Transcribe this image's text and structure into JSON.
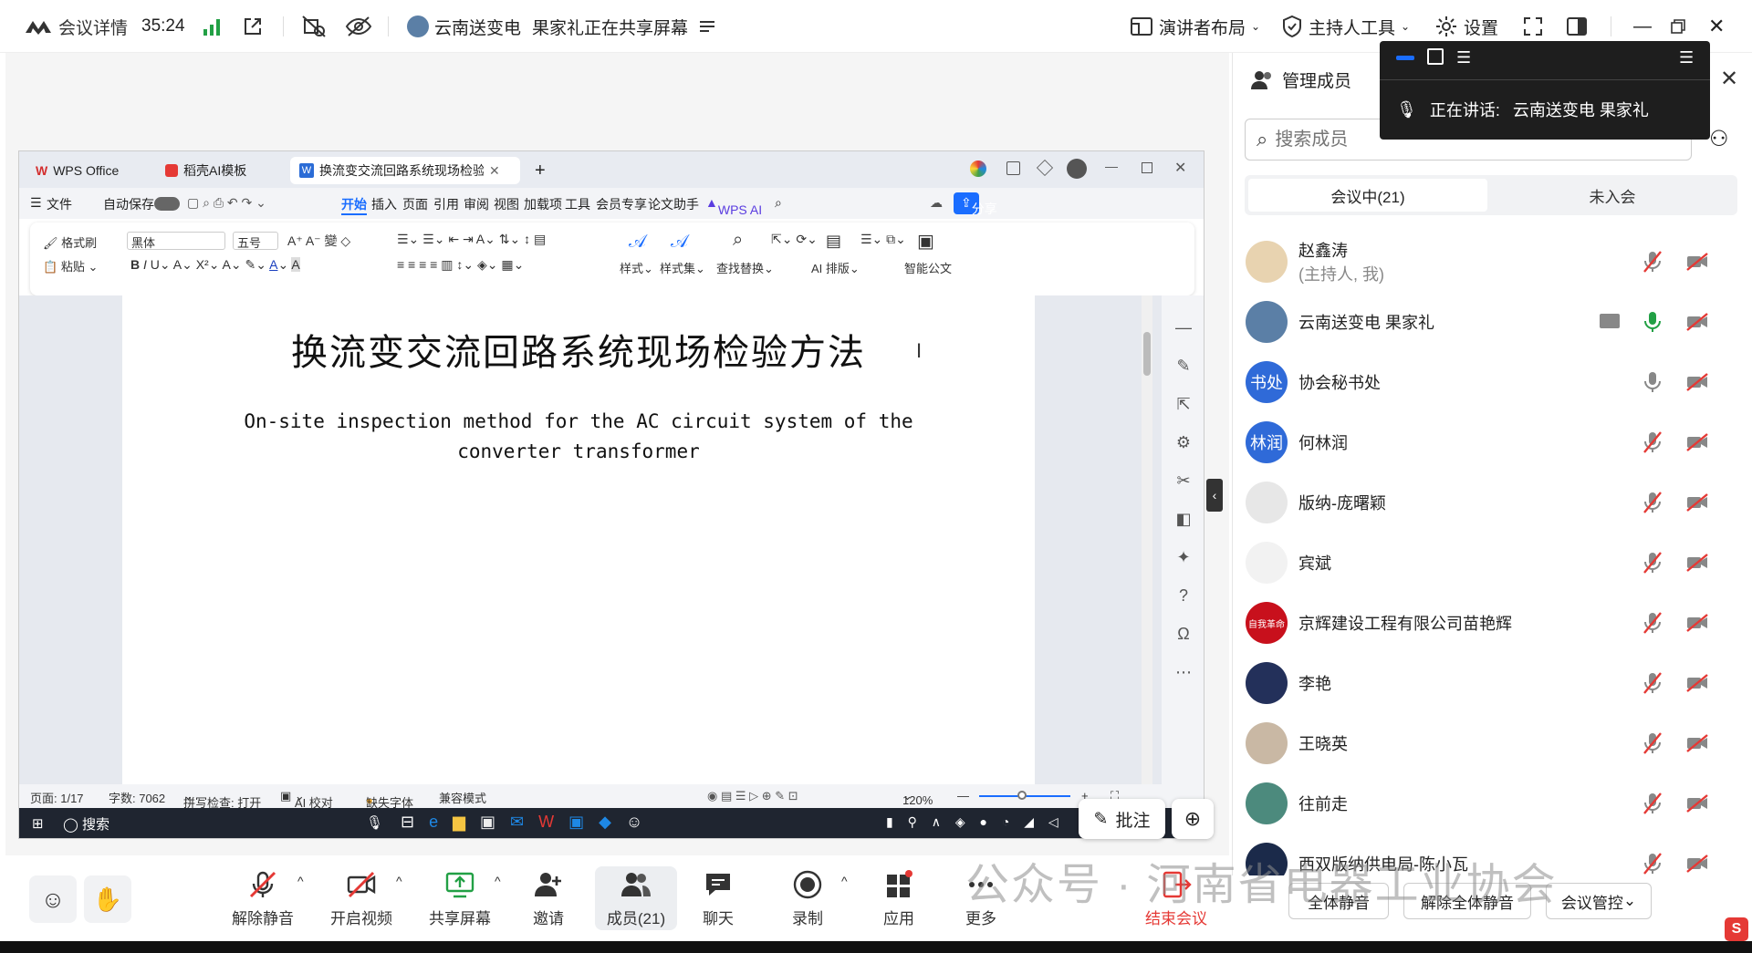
{
  "topbar": {
    "meeting_details": "会议详情",
    "timer": "35:24",
    "sharer_org": "云南送变电",
    "sharer_status": "果家礼正在共享屏幕",
    "presenter_layout": "演讲者布局",
    "host_tools": "主持人工具",
    "settings": "设置"
  },
  "wps": {
    "tabs": [
      {
        "label": "WPS Office"
      },
      {
        "label": "稻壳AI模板"
      },
      {
        "label": "换流变交流回路系统现场检验"
      }
    ],
    "menu": {
      "file": "文件",
      "autosave": "自动保存",
      "items": [
        "开始",
        "插入",
        "页面",
        "引用",
        "审阅",
        "视图",
        "加载项",
        "工具",
        "会员专享",
        "论文助手"
      ],
      "wps_ai": "WPS AI",
      "share": "分享"
    },
    "ribbon": {
      "format_painter": "格式刷",
      "paste": "粘贴",
      "font_name": "黑体",
      "font_size": "五号",
      "style": "样式",
      "style_set": "样式集",
      "find_replace": "查找替换",
      "ai_layout": "AI 排版",
      "smart_doc": "智能公文"
    },
    "document": {
      "title": "换流变交流回路系统现场检验方法",
      "subtitle": "On-site inspection method for the AC circuit system of the converter transformer"
    },
    "status": {
      "page": "页面: 1/17",
      "word_count": "字数: 7062",
      "spell_check": "拼写检查: 打开",
      "ai_proofread": "AI 校对",
      "missing_font": "缺失字体",
      "compat_mode": "兼容模式",
      "zoom": "120%"
    },
    "taskbar": {
      "search": "搜索"
    }
  },
  "annotate_button": "批注",
  "panel": {
    "title": "管理成员",
    "search_placeholder": "搜索成员",
    "tab_in_meeting": "会议中(21)",
    "tab_not_joined": "未入会",
    "members": [
      {
        "name": "赵鑫涛",
        "sub": "(主持人, 我)",
        "avatar_text": "",
        "color": "#e8d3b0"
      },
      {
        "name": "云南送变电  果家礼",
        "sub": "",
        "avatar_text": "",
        "color": "#5b7fa6"
      },
      {
        "name": "协会秘书处",
        "sub": "",
        "avatar_text": "书处",
        "color": "#2f6ad8"
      },
      {
        "name": "何林润",
        "sub": "",
        "avatar_text": "林润",
        "color": "#2f6ad8"
      },
      {
        "name": "版纳-庞曙颖",
        "sub": "",
        "avatar_text": "",
        "color": "#e7e7e7"
      },
      {
        "name": "宾斌",
        "sub": "",
        "avatar_text": "",
        "color": "#f2f2f2"
      },
      {
        "name": "京辉建设工程有限公司苗艳辉",
        "sub": "",
        "avatar_text": "自我革命",
        "color": "#c8101c"
      },
      {
        "name": "李艳",
        "sub": "",
        "avatar_text": "",
        "color": "#23305a"
      },
      {
        "name": "王晓英",
        "sub": "",
        "avatar_text": "",
        "color": "#c9b8a4"
      },
      {
        "name": "往前走",
        "sub": "",
        "avatar_text": "",
        "color": "#4c8a7d"
      },
      {
        "name": "西双版纳供电局-陈小瓦",
        "sub": "",
        "avatar_text": "",
        "color": "#1b2a4a"
      }
    ],
    "mute_all": "全体静音",
    "unmute_all": "解除全体静音",
    "meeting_control": "会议管控"
  },
  "floater": {
    "speaking_label": "正在讲话:",
    "speaker": "云南送变电  果家礼"
  },
  "bottombar": {
    "unmute": "解除静音",
    "start_video": "开启视频",
    "share_screen": "共享屏幕",
    "invite": "邀请",
    "members": "成员(21)",
    "chat": "聊天",
    "record": "录制",
    "apps": "应用",
    "more": "更多",
    "end_meeting": "结束会议"
  },
  "watermark": "公众号 · 河南省电器工业协会",
  "colors": {
    "accent": "#1a6dff",
    "end": "#e53935",
    "wps_red": "#d32f2f"
  }
}
